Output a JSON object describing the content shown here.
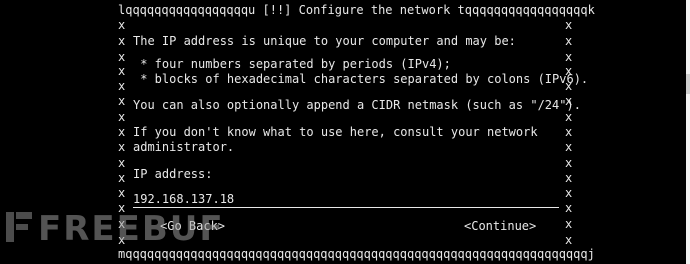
{
  "dialog": {
    "top_border": "lqqqqqqqqqqqqqqqqqu [!!] Configure the network tqqqqqqqqqqqqqqqqqk",
    "bottom_border": "mqqqqqqqqqqqqqqqqqqqqqqqqqqqqqqqqqqqqqqqqqqqqqqqqqqqqqqqqqqqqqqqqj",
    "edge_char": "x",
    "lines": {
      "l1": "The IP address is unique to your computer and may be:",
      "l2": " * four numbers separated by periods (IPv4);",
      "l3": " * blocks of hexadecimal characters separated by colons (IPv6).",
      "l4": "You can also optionally append a CIDR netmask (such as \"/24\").",
      "l5": "If you don't know what to use here, consult your network",
      "l6": "administrator.",
      "l7": "IP address:"
    },
    "ip_input_value": "192.168.137.18",
    "back_button": "<Go Back>",
    "continue_button": "<Continue>"
  },
  "watermark": {
    "text": "FREEBUF"
  },
  "colors": {
    "background": "#000000",
    "text": "#e8e8e8"
  }
}
